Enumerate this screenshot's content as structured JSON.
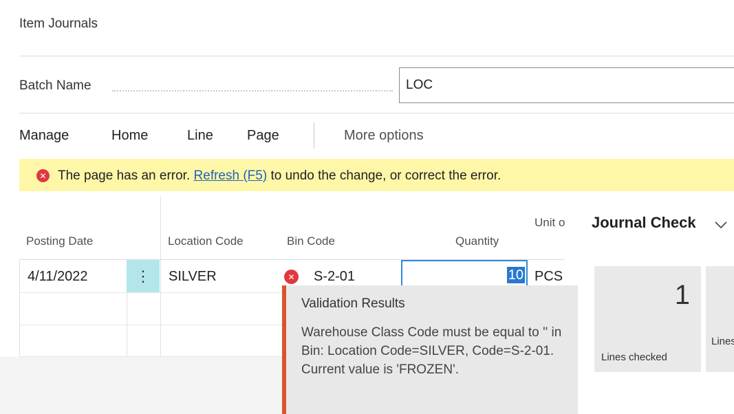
{
  "page_title": "Item Journals",
  "batch": {
    "label": "Batch Name",
    "value": "LOC"
  },
  "menu": {
    "items": [
      "Manage",
      "Home",
      "Line",
      "Page"
    ],
    "more": "More options"
  },
  "error_bar": {
    "prefix": "The page has an error.",
    "link": "Refresh (F5)",
    "suffix": "to undo the change, or correct the error."
  },
  "columns": {
    "posting_date": "Posting Date",
    "location_code": "Location Code",
    "bin_code": "Bin Code",
    "quantity": "Quantity",
    "unit_of_measure": "Unit of Measure"
  },
  "row": {
    "posting_date": "4/11/2022",
    "location_code": "SILVER",
    "bin_code": "S-2-01",
    "quantity": "10",
    "unit_of_measure": "PCS"
  },
  "tooltip": {
    "title": "Validation Results",
    "message": "Warehouse Class Code must be equal to '' in Bin: Location Code=SILVER, Code=S-2-01. Current value is 'FROZEN'."
  },
  "factbox": {
    "title": "Journal Check",
    "tiles": [
      {
        "value": "1",
        "label": "Lines checked"
      },
      {
        "value": "",
        "label": "Lines with issues"
      }
    ]
  },
  "colors": {
    "error_icon": "#e0383e",
    "error_bar_bg": "#fff7a8",
    "tooltip_accent": "#d9552d",
    "focus_border": "#2f8bd6"
  }
}
